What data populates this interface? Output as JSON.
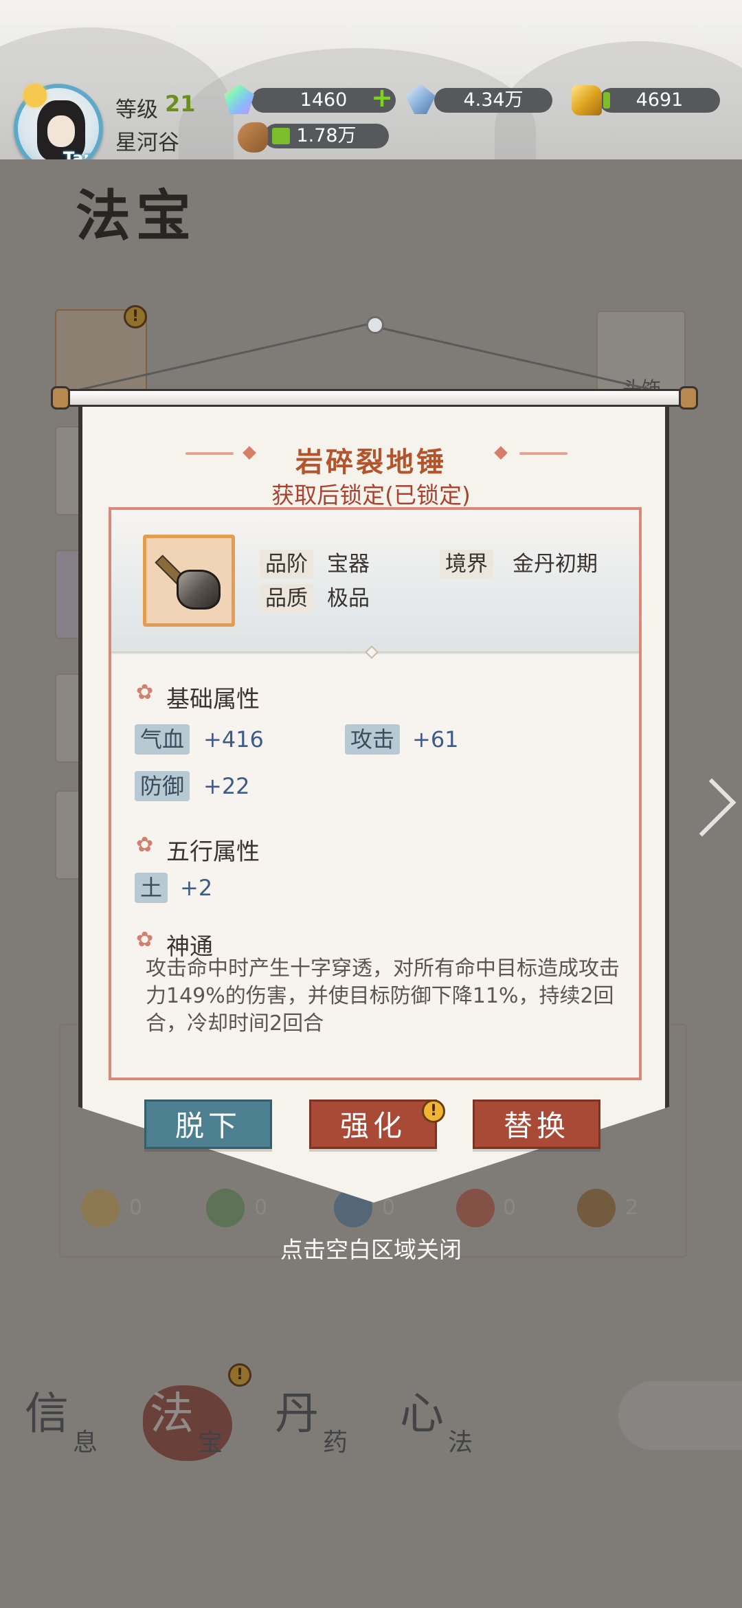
{
  "header": {
    "level_label": "等级",
    "level_value": "21",
    "location": "星河谷",
    "avatar_tap": "Tap",
    "resources": {
      "gems": "1460",
      "crystals": "4.34万",
      "gold": "4691",
      "wood": "1.78万"
    }
  },
  "page": {
    "title": "法宝",
    "side_label": "头饰"
  },
  "dialog": {
    "item_name": "岩碎裂地锤",
    "lock_status": "获取后锁定(已锁定)",
    "meta": {
      "grade_label": "品阶",
      "grade_value": "宝器",
      "quality_label": "品质",
      "quality_value": "极品",
      "realm_label": "境界",
      "realm_value": "金丹初期"
    },
    "base_section": "基础属性",
    "base_stats": [
      {
        "name": "气血",
        "value": "+416"
      },
      {
        "name": "攻击",
        "value": "+61"
      },
      {
        "name": "防御",
        "value": "+22"
      }
    ],
    "element_section": "五行属性",
    "element_stats": [
      {
        "name": "土",
        "value": "+2"
      }
    ],
    "skill_section": "神通",
    "skill_text": "攻击命中时产生十字穿透，对所有命中目标造成攻击力149%的伤害，并使目标防御下降11%，持续2回合，冷却时间2回合",
    "buttons": {
      "remove": "脱下",
      "enhance": "强化",
      "replace": "替换"
    },
    "badge": "!",
    "close_hint": "点击空白区域关闭"
  },
  "elements_row": [
    {
      "name": "金",
      "value": "0"
    },
    {
      "name": "木",
      "value": "0"
    },
    {
      "name": "水",
      "value": "0"
    },
    {
      "name": "火",
      "value": "0"
    },
    {
      "name": "土",
      "value": "2"
    }
  ],
  "bottom_nav": [
    {
      "big": "信",
      "small": "息"
    },
    {
      "big": "法",
      "small": "宝"
    },
    {
      "big": "丹",
      "small": "药"
    },
    {
      "big": "心",
      "small": "法"
    }
  ],
  "colors": {
    "accent_red": "#a94a36",
    "accent_blue": "#4c7f8f",
    "title_orange": "#b2542c"
  }
}
